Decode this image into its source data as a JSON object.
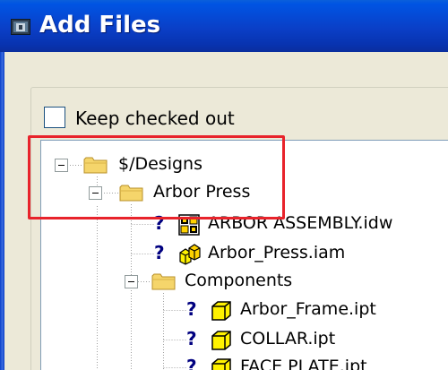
{
  "window": {
    "title": "Add Files",
    "icon": "vault-app-icon"
  },
  "options": {
    "keep_checked_out_label": "Keep checked out",
    "keep_checked_out_checked": false
  },
  "tree": {
    "root": {
      "label": "$/Designs",
      "icon": "folder-icon",
      "expanded": true
    },
    "arbor_press": {
      "label": "Arbor Press",
      "icon": "folder-icon",
      "expanded": true
    },
    "files": [
      {
        "label": "ARBOR ASSEMBLY.idw",
        "icon": "drawing-icon",
        "status": "?"
      },
      {
        "label": "Arbor_Press.iam",
        "icon": "assembly-icon",
        "status": "?"
      }
    ],
    "components": {
      "label": "Components",
      "icon": "folder-icon",
      "expanded": true
    },
    "component_files": [
      {
        "label": "Arbor_Frame.ipt",
        "icon": "part-icon",
        "status": "?"
      },
      {
        "label": "COLLAR.ipt",
        "icon": "part-icon",
        "status": "?"
      },
      {
        "label": "FACE PLATE.ipt",
        "icon": "part-icon",
        "status": "?"
      }
    ]
  },
  "annotation": {
    "color": "#E8232B"
  },
  "colors": {
    "titlebar": "#0A3FC7",
    "dialog_bg": "#ECE9D8",
    "folder": "#F5D56B",
    "part": "#FFF200"
  }
}
